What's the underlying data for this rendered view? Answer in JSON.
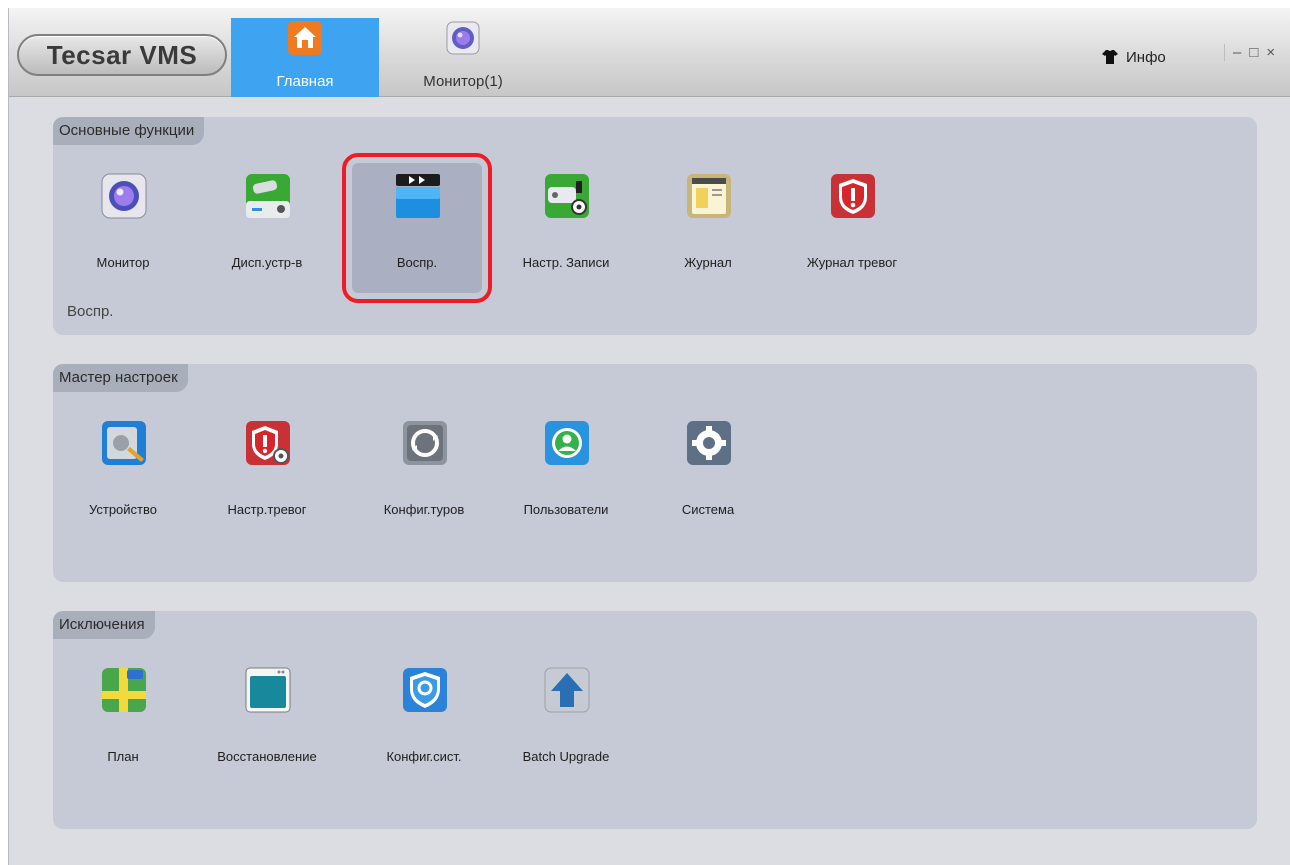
{
  "app": {
    "title": "Tecsar VMS",
    "tabs": [
      {
        "label": "Главная",
        "icon": "home-icon"
      },
      {
        "label": "Монитор(1)",
        "icon": "camera-lens-icon"
      }
    ],
    "info_label": "Инфо",
    "window_controls": [
      "–",
      "□",
      "×"
    ]
  },
  "sections": [
    {
      "title": "Основные функции",
      "items": [
        {
          "label": "Монитор",
          "icon": "camera-lens-icon"
        },
        {
          "label": "Дисп.устр-в",
          "icon": "cctv-device-icon"
        },
        {
          "label": "Воспр.",
          "icon": "clapperboard-icon"
        },
        {
          "label": "Настр. Записи",
          "icon": "camera-settings-icon"
        },
        {
          "label": "Журнал",
          "icon": "log-book-icon"
        },
        {
          "label": "Журнал тревог",
          "icon": "alarm-shield-icon"
        }
      ],
      "status": "Воспр."
    },
    {
      "title": "Мастер настроек",
      "items": [
        {
          "label": "Устройство",
          "icon": "device-tools-icon"
        },
        {
          "label": "Настр.тревог",
          "icon": "alarm-settings-icon"
        },
        {
          "label": "Конфиг.туров",
          "icon": "tour-cycle-icon"
        },
        {
          "label": "Пользователи",
          "icon": "user-icon"
        },
        {
          "label": "Система",
          "icon": "gear-icon"
        }
      ]
    },
    {
      "title": "Исключения",
      "items": [
        {
          "label": "План",
          "icon": "map-icon"
        },
        {
          "label": "Восстановление",
          "icon": "window-icon"
        },
        {
          "label": "Конфиг.сист.",
          "icon": "config-shield-icon"
        },
        {
          "label": "Batch Upgrade",
          "icon": "upload-arrow-icon"
        }
      ]
    }
  ],
  "colors": {
    "active_tab": "#3ea3f0",
    "panel_bg": "#c5cad6",
    "highlight_border": "#ee1c24"
  }
}
